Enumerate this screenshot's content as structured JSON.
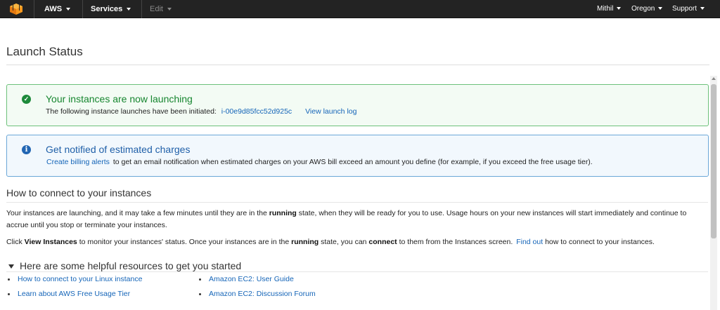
{
  "topbar": {
    "logo_icon": "aws-cube-icon",
    "aws_label": "AWS",
    "services_label": "Services",
    "edit_label": "Edit",
    "user_label": "Mithil",
    "region_label": "Oregon",
    "support_label": "Support",
    "bg_color": "#232323"
  },
  "page": {
    "title": "Launch Status"
  },
  "success_alert": {
    "icon": "check-circle-icon",
    "title": "Your instances are now launching",
    "text_prefix": "The following instance launches have been initiated:",
    "instance_id": "i-00e9d85fcc52d925c",
    "view_log_link": "View launch log",
    "color": "#16862f"
  },
  "info_alert": {
    "icon": "info-circle-icon",
    "title": "Get notified of estimated charges",
    "link": "Create billing alerts",
    "text_suffix": "to get an email notification when estimated charges on your AWS bill exceed an amount you define (for example, if you exceed the free usage tier).",
    "color": "#1f5fa8"
  },
  "connect_section": {
    "heading": "How to connect to your instances",
    "p1_a": "Your instances are launching, and it may take a few minutes until they are in the",
    "p1_bold": "running",
    "p1_b": "state, when they will be ready for you to use. Usage hours on your new instances will start immediately and continue to accrue until you stop or terminate your instances.",
    "p2_a": "Click",
    "p2_bold1": "View Instances",
    "p2_b": "to monitor your instances' status. Once your instances are in the",
    "p2_bold2": "running",
    "p2_c": "state, you can",
    "p2_bold3": "connect",
    "p2_d": "to them from the Instances screen.",
    "p2_link": "Find out",
    "p2_e": "how to connect to your instances."
  },
  "resources": {
    "heading": "Here are some helpful resources to get you started",
    "left": [
      "How to connect to your Linux instance",
      "Learn about AWS Free Usage Tier"
    ],
    "right": [
      "Amazon EC2: User Guide",
      "Amazon EC2: Discussion Forum"
    ]
  }
}
